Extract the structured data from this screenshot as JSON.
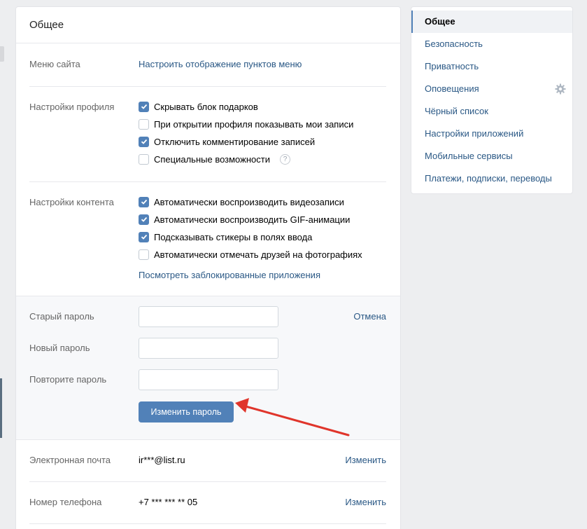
{
  "page_title": "Общее",
  "menu": {
    "label": "Меню сайта",
    "link": "Настроить отображение пунктов меню"
  },
  "profile": {
    "label": "Настройки профиля",
    "items": [
      {
        "text": "Скрывать блок подарков",
        "checked": true
      },
      {
        "text": "При открытии профиля показывать мои записи",
        "checked": false
      },
      {
        "text": "Отключить комментирование записей",
        "checked": true
      },
      {
        "text": "Специальные возможности",
        "checked": false
      }
    ],
    "help": "?"
  },
  "content": {
    "label": "Настройки контента",
    "items": [
      {
        "text": "Автоматически воспроизводить видеозаписи",
        "checked": true
      },
      {
        "text": "Автоматически воспроизводить GIF-анимации",
        "checked": true
      },
      {
        "text": "Подсказывать стикеры в полях ввода",
        "checked": true
      },
      {
        "text": "Автоматически отмечать друзей на фотографиях",
        "checked": false
      }
    ],
    "blocked_link": "Посмотреть заблокированные приложения"
  },
  "password": {
    "old_label": "Старый пароль",
    "new_label": "Новый пароль",
    "repeat_label": "Повторите пароль",
    "old_value": "",
    "new_value": "",
    "repeat_value": "",
    "cancel": "Отмена",
    "submit": "Изменить пароль"
  },
  "email": {
    "label": "Электронная почта",
    "value": "ir***@list.ru",
    "action": "Изменить"
  },
  "phone": {
    "label": "Номер телефона",
    "value": "+7 *** *** ** 05",
    "action": "Изменить"
  },
  "sidebar": {
    "items": [
      {
        "label": "Общее",
        "active": true
      },
      {
        "label": "Безопасность"
      },
      {
        "label": "Приватность"
      },
      {
        "label": "Оповещения",
        "icon": "gear-icon"
      },
      {
        "label": "Чёрный список"
      },
      {
        "label": "Настройки приложений"
      },
      {
        "label": "Мобильные сервисы"
      },
      {
        "label": "Платежи, подписки, переводы"
      }
    ]
  },
  "colors": {
    "accent": "#5181b8",
    "link": "#2a5885",
    "background": "#edeef0",
    "annotation_arrow": "#e0352b"
  }
}
